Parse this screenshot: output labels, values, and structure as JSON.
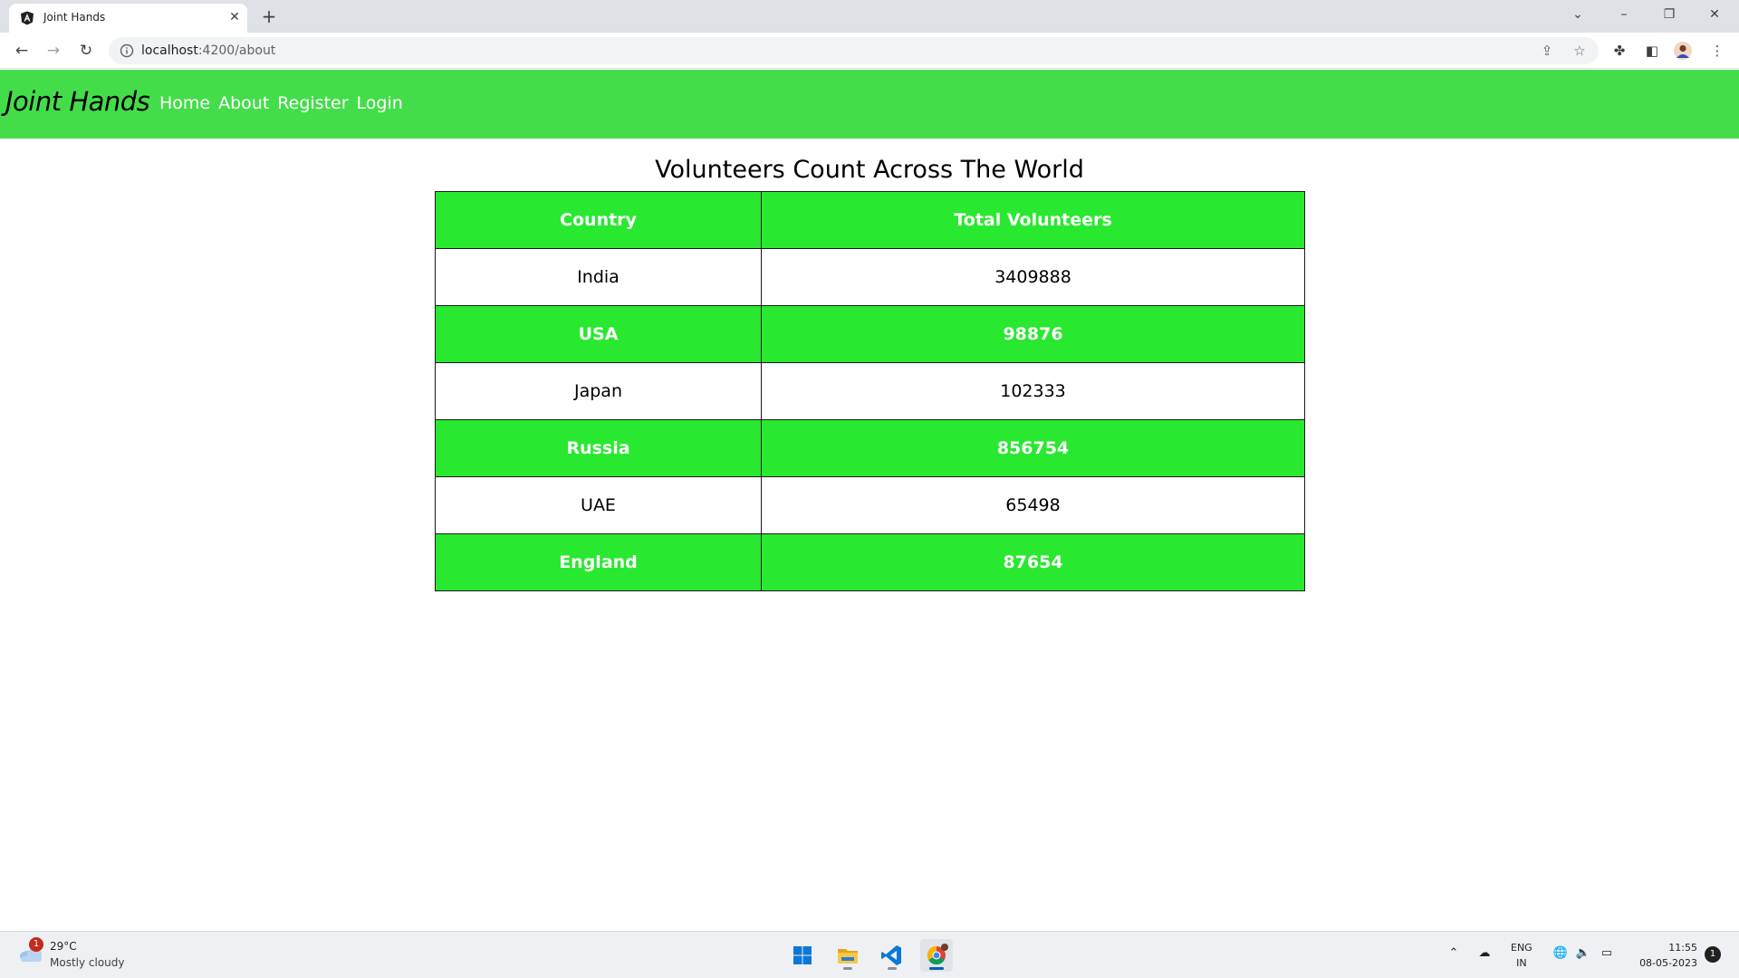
{
  "browser": {
    "tab_title": "Joint Hands",
    "tab_close_icon": "close-icon",
    "new_tab_icon": "plus-icon",
    "url_host": "localhost",
    "url_path": ":4200/about"
  },
  "navbar": {
    "brand": "Joint Hands",
    "links": [
      "Home",
      "About",
      "Register",
      "Login"
    ],
    "background_color": "#44dd4a"
  },
  "page": {
    "title": "Volunteers Count Across The World",
    "table": {
      "headers": [
        "Country",
        "Total Volunteers"
      ],
      "rows": [
        [
          "India",
          "3409888"
        ],
        [
          "USA",
          "98876"
        ],
        [
          "Japan",
          "102333"
        ],
        [
          "Russia",
          "856754"
        ],
        [
          "UAE",
          "65498"
        ],
        [
          "England",
          "87654"
        ]
      ],
      "accent_color": "#29e830"
    }
  },
  "taskbar": {
    "weather_badge": "1",
    "weather_temp": "29°C",
    "weather_desc": "Mostly cloudy",
    "lang_line1": "ENG",
    "lang_line2": "IN",
    "time": "11:55",
    "date": "08-05-2023",
    "notification_count": "1"
  }
}
